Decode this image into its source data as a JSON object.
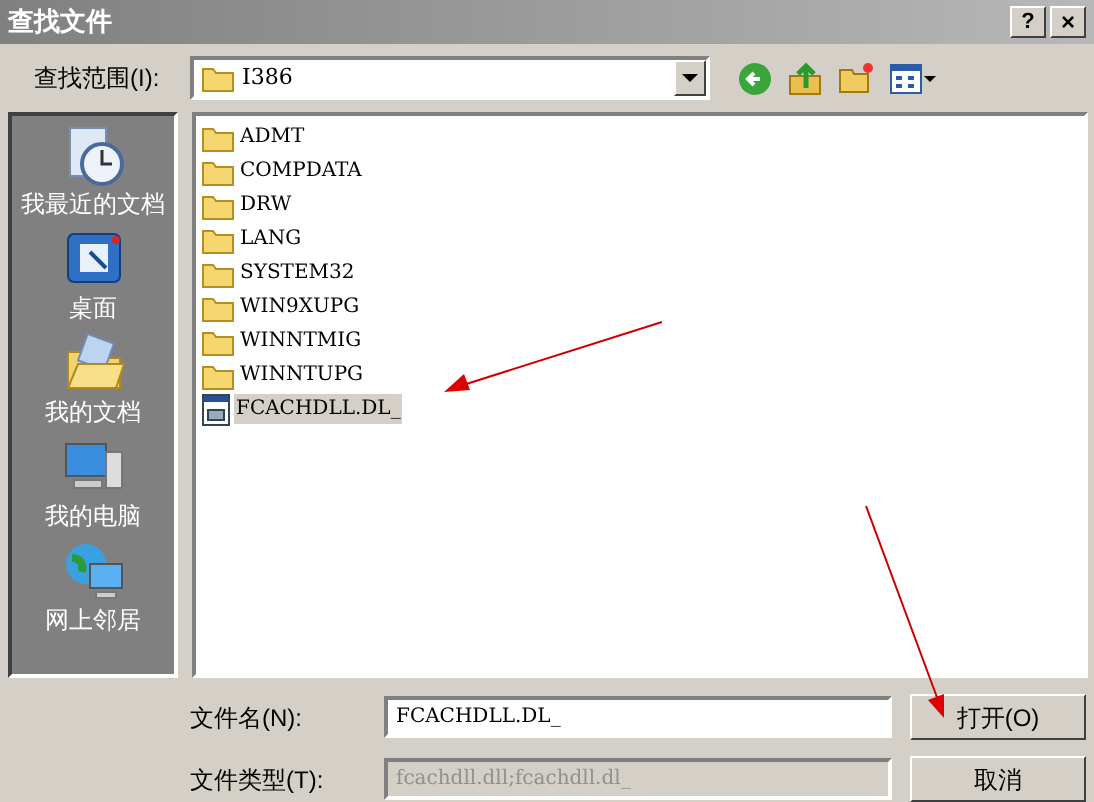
{
  "window": {
    "title": "查找文件",
    "help_button": "?",
    "close_button": "×"
  },
  "look_in": {
    "label": "查找范围(I):",
    "value": "I386"
  },
  "places": [
    {
      "label": "我最近的文档",
      "kind": "recent"
    },
    {
      "label": "桌面",
      "kind": "desktop"
    },
    {
      "label": "我的文档",
      "kind": "documents"
    },
    {
      "label": "我的电脑",
      "kind": "computer"
    },
    {
      "label": "网上邻居",
      "kind": "network"
    }
  ],
  "files": [
    {
      "name": "ADMT",
      "kind": "folder",
      "selected": false
    },
    {
      "name": "COMPDATA",
      "kind": "folder",
      "selected": false
    },
    {
      "name": "DRW",
      "kind": "folder",
      "selected": false
    },
    {
      "name": "LANG",
      "kind": "folder",
      "selected": false
    },
    {
      "name": "SYSTEM32",
      "kind": "folder",
      "selected": false
    },
    {
      "name": "WIN9XUPG",
      "kind": "folder",
      "selected": false
    },
    {
      "name": "WINNTMIG",
      "kind": "folder",
      "selected": false
    },
    {
      "name": "WINNTUPG",
      "kind": "folder",
      "selected": false
    },
    {
      "name": "FCACHDLL.DL_",
      "kind": "file",
      "selected": true
    }
  ],
  "file_name": {
    "label": "文件名(N):",
    "value": "FCACHDLL.DL_"
  },
  "file_type": {
    "label": "文件类型(T):",
    "value": "fcachdll.dll;fcachdll.dl_",
    "disabled": true
  },
  "buttons": [
    "打开(O)",
    "取消"
  ]
}
